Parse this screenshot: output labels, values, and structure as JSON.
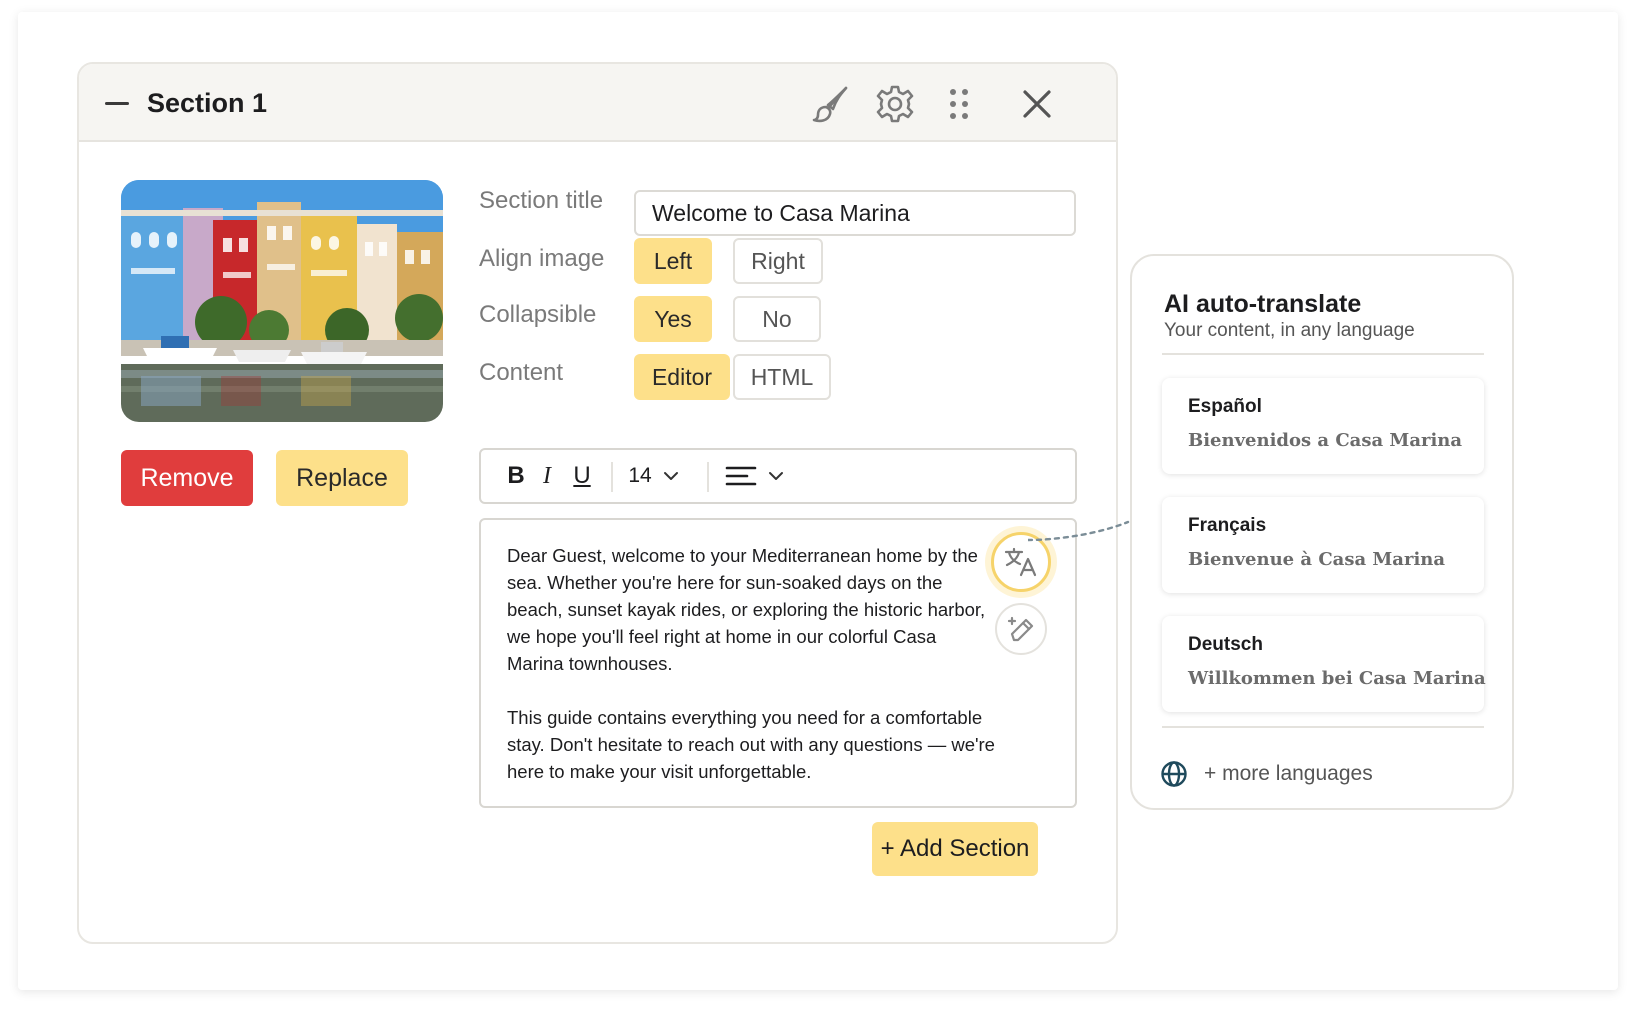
{
  "section": {
    "title": "Section 1",
    "header_icons": [
      "brush-icon",
      "gear-icon",
      "drag-handle-icon",
      "close-icon"
    ],
    "image_alt": "Colorful Casa Marina townhouses by the harbor",
    "remove_label": "Remove",
    "replace_label": "Replace"
  },
  "form": {
    "section_title_label": "Section title",
    "section_title_value": "Welcome to Casa Marina",
    "align_label": "Align image",
    "align_options": [
      "Left",
      "Right"
    ],
    "align_selected": "Left",
    "collapsible_label": "Collapsible",
    "collapsible_options": [
      "Yes",
      "No"
    ],
    "collapsible_selected": "Yes",
    "content_label": "Content",
    "content_options": [
      "Editor",
      "HTML"
    ],
    "content_selected": "Editor"
  },
  "toolbar": {
    "bold": "B",
    "italic": "I",
    "underline": "U",
    "font_size": "14"
  },
  "editor": {
    "paragraph_1": "Dear Guest, welcome to your Mediterranean home by the sea. Whether you're here for sun-soaked days on the beach, sunset kayak rides, or exploring the historic harbor, we hope you'll feel right at home in our colorful Casa Marina townhouses.",
    "paragraph_2": "This guide contains everything you need for a comfortable stay. Don't hesitate to reach out with any questions — we're here to make your visit unforgettable."
  },
  "add_section_label": "+ Add Section",
  "translate_panel": {
    "title": "AI auto-translate",
    "subtitle": "Your content, in any language",
    "languages": [
      {
        "name": "Español",
        "text": "Bienvenidos a Casa Marina"
      },
      {
        "name": "Français",
        "text": "Bienvenue à Casa Marina"
      },
      {
        "name": "Deutsch",
        "text": "Willkommen bei Casa Marina"
      }
    ],
    "more_label": "+ more languages"
  },
  "colors": {
    "accent_yellow": "#fde08a",
    "danger_red": "#e03d3d",
    "header_bg": "#f6f5f2"
  }
}
